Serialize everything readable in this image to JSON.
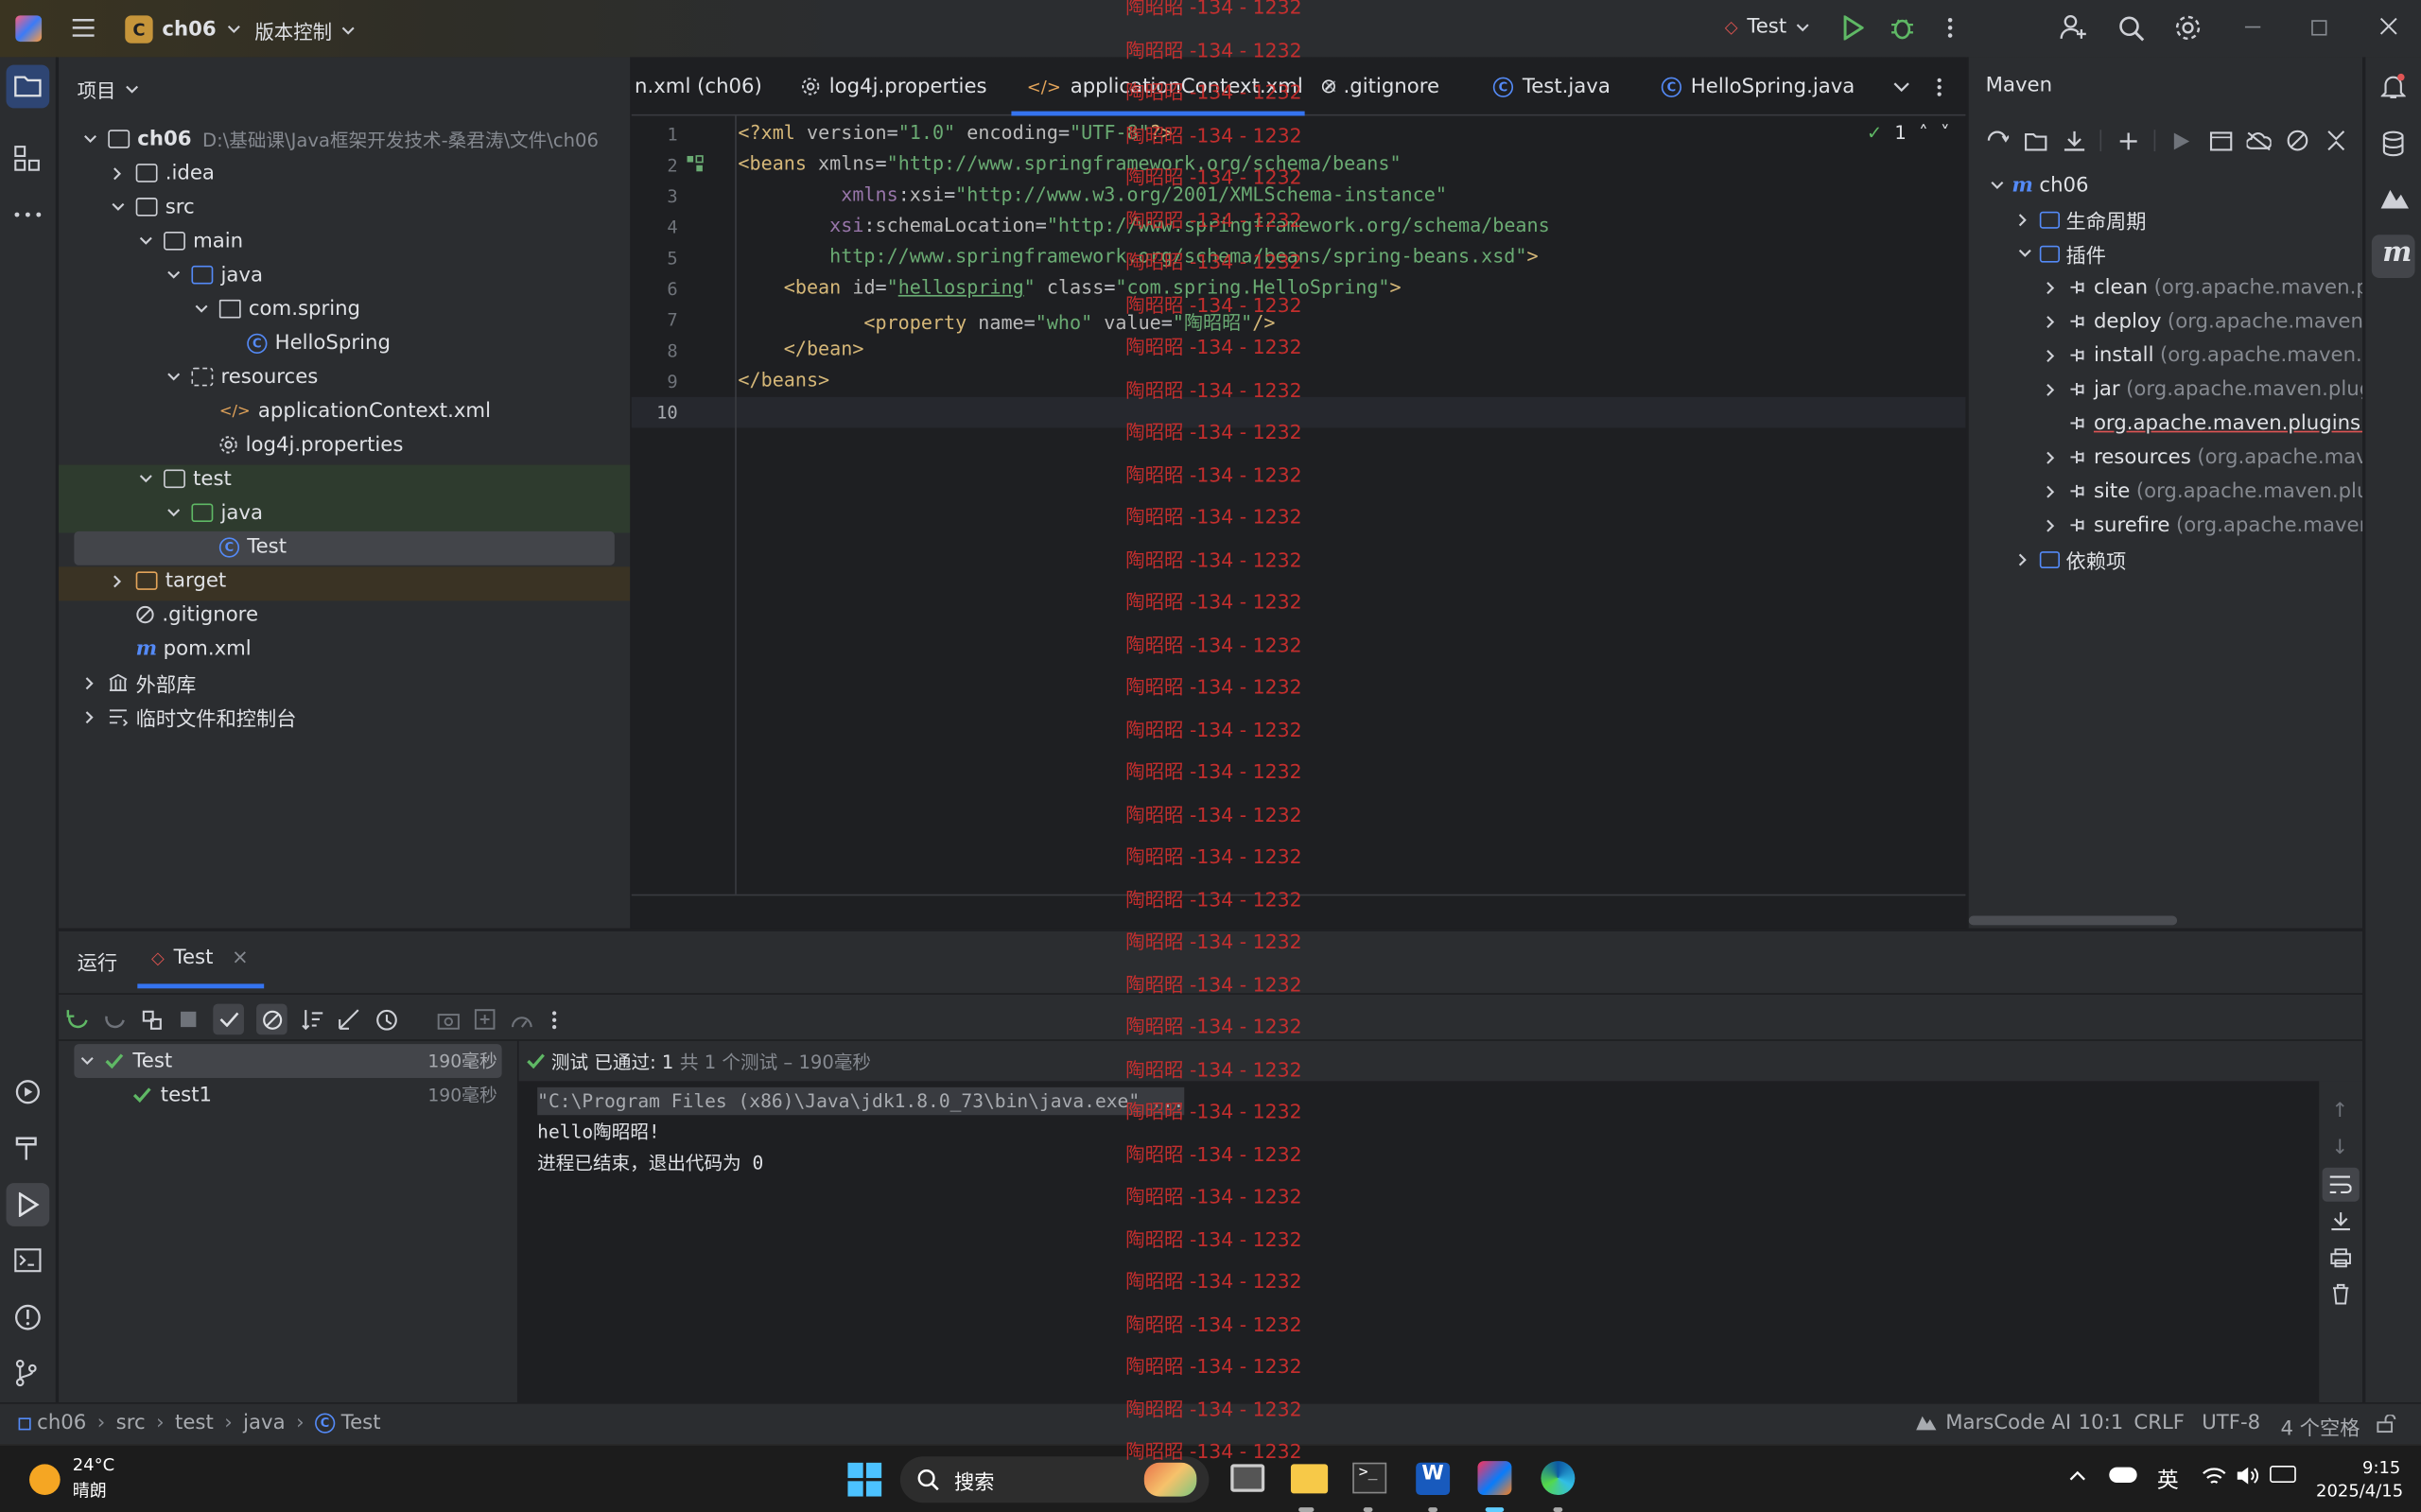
{
  "titlebar": {
    "project": "ch06",
    "project_badge": "C",
    "vcs": "版本控制",
    "run_config": "Test"
  },
  "project_panel": {
    "title": "项目",
    "root_name": "ch06",
    "root_path": "D:\\基础课\\Java框架开发技术-桑君涛\\文件\\ch06",
    "items": [
      ".idea",
      "src",
      "main",
      "java",
      "com.spring",
      "HelloSpring",
      "resources",
      "applicationContext.xml",
      "log4j.properties",
      "test",
      "java",
      "Test",
      "target",
      ".gitignore",
      "pom.xml",
      "外部库",
      "临时文件和控制台"
    ]
  },
  "tabs": [
    "n.xml (ch06)",
    "log4j.properties",
    "applicationContext.xml",
    "⊘ .gitignore",
    "Test.java",
    "HelloSpring.java"
  ],
  "editor": {
    "warn_count": "1",
    "lines": [
      "1",
      "2",
      "3",
      "4",
      "5",
      "6",
      "7",
      "8",
      "9",
      "10"
    ]
  },
  "maven": {
    "title": "Maven",
    "root": "ch06",
    "lifecycle": "生命周期",
    "plugins": "插件",
    "deps": "依赖项",
    "plugin_items": [
      {
        "name": "clean",
        "coord": "(org.apache.maven.plugins"
      },
      {
        "name": "deploy",
        "coord": "(org.apache.maven.plugins"
      },
      {
        "name": "install",
        "coord": "(org.apache.maven.plugins"
      },
      {
        "name": "jar",
        "coord": "(org.apache.maven.plugins:"
      },
      {
        "name": "org.apache.maven.plugins:mav",
        "coord": ""
      },
      {
        "name": "resources",
        "coord": "(org.apache.maven.p"
      },
      {
        "name": "site",
        "coord": "(org.apache.maven.plugins"
      },
      {
        "name": "surefire",
        "coord": "(org.apache.maven.plu"
      }
    ]
  },
  "run": {
    "label": "运行",
    "tab": "Test",
    "tree_root": "Test",
    "tree_root_time": "190毫秒",
    "tree_child": "test1",
    "tree_child_time": "190毫秒",
    "status_strong": "测试 已通过: 1",
    "status_dim": "共 1 个测试 – 190毫秒",
    "console": [
      "\"C:\\Program Files (x86)\\Java\\jdk1.8.0_73\\bin\\java.exe\" ...",
      "hello陶昭昭!",
      "进程已结束，退出代码为 0"
    ]
  },
  "statusbar": {
    "crumbs": [
      "ch06",
      "src",
      "test",
      "java",
      "Test"
    ],
    "ai": "MarsCode AI",
    "pos": "10:1",
    "eol": "CRLF",
    "enc": "UTF-8",
    "indent": "4 个空格"
  },
  "taskbar": {
    "temp": "24°C",
    "weather": "晴朗",
    "search": "搜索",
    "ime": "英",
    "time": "9:15",
    "date": "2025/4/15"
  },
  "watermark": "陶昭昭 -134 - 1232",
  "colors": {
    "accent": "#548af7",
    "success": "#5fb865",
    "watermark": "#d4302f",
    "run_green": "#5fb865"
  }
}
